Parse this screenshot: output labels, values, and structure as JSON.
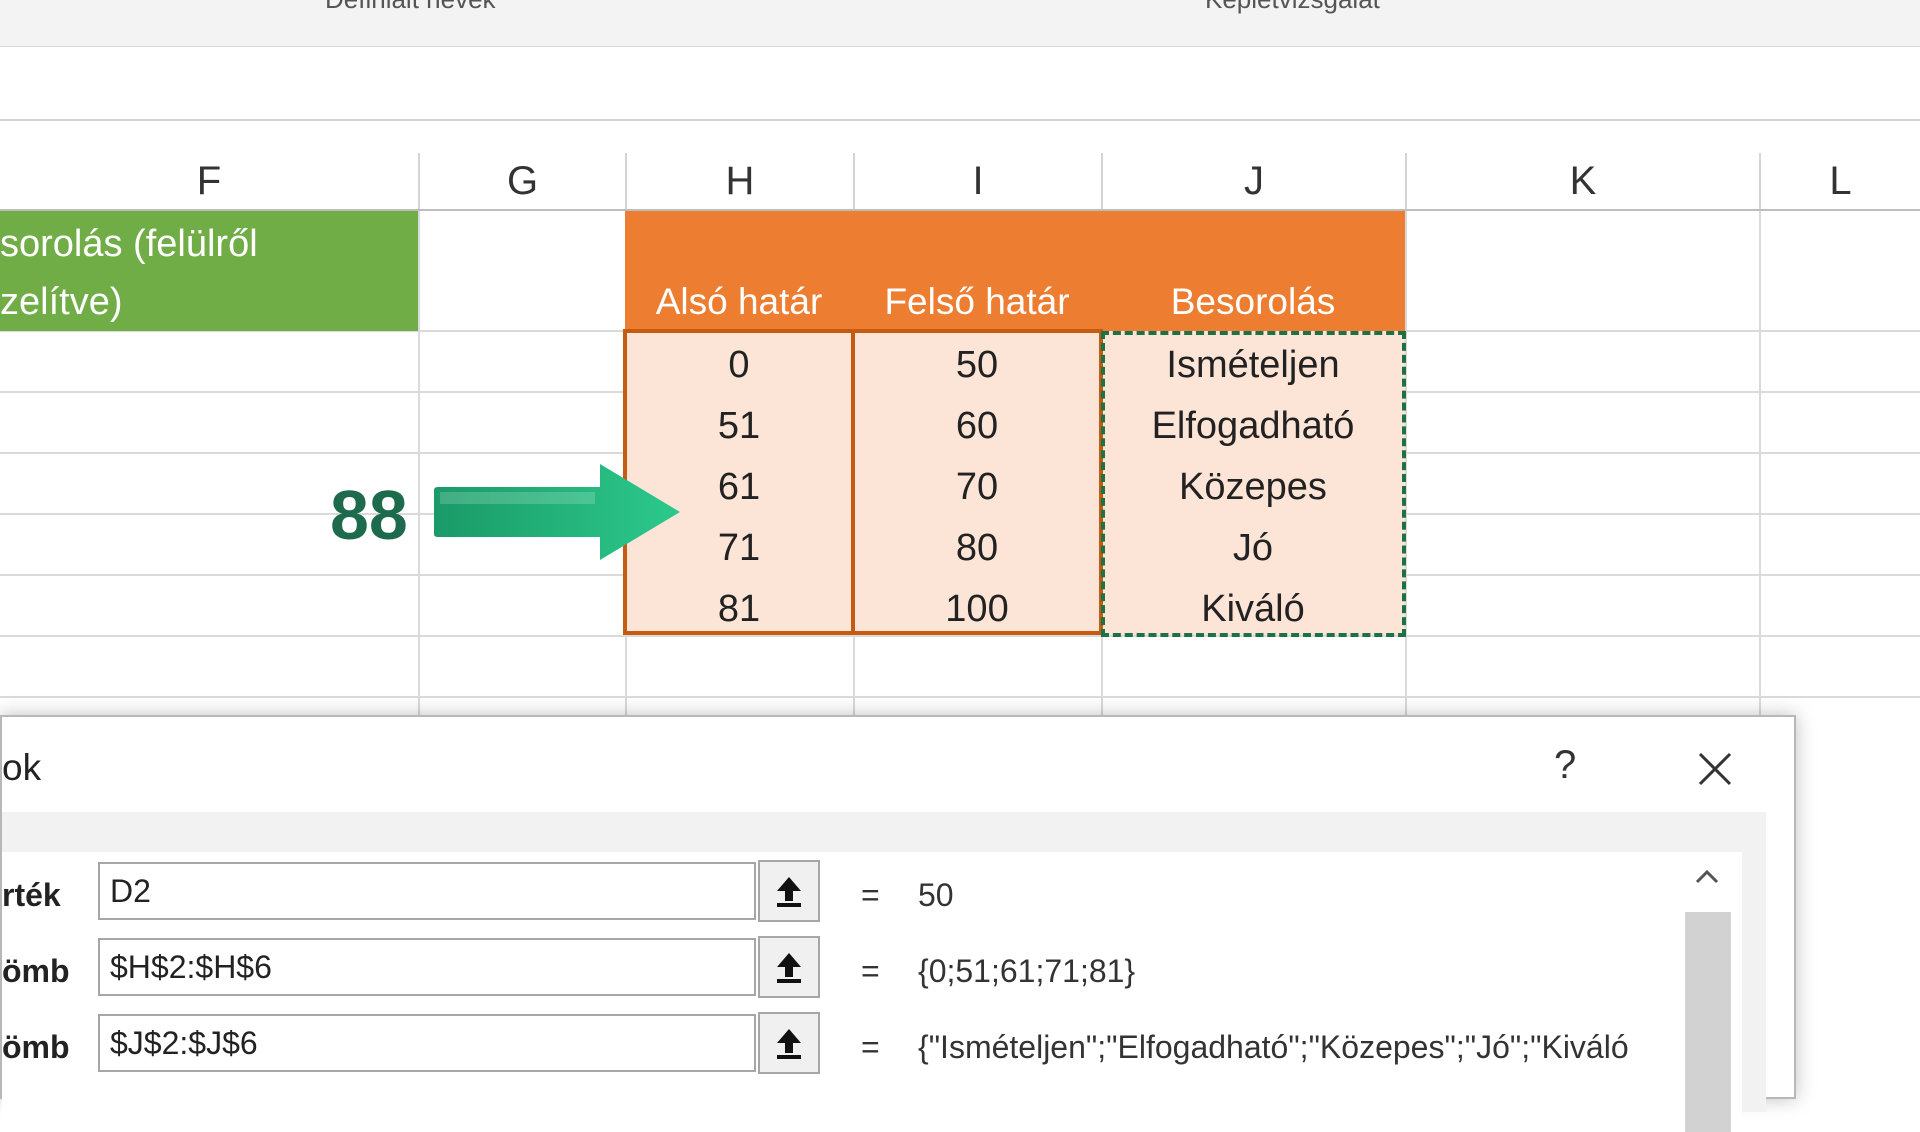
{
  "ribbon": {
    "left_text": "Definiált nevek",
    "right_text": "Képletvizsgálat"
  },
  "columns": [
    "F",
    "G",
    "H",
    "I",
    "J",
    "K",
    "L"
  ],
  "green_header": {
    "line1": "sorolás (felülről",
    "line2": "zelítve)"
  },
  "table": {
    "headers": [
      "Alsó határ",
      "Felső határ",
      "Besorolás"
    ],
    "lower": [
      "0",
      "51",
      "61",
      "71",
      "81"
    ],
    "upper": [
      "50",
      "60",
      "70",
      "80",
      "100"
    ],
    "grade": [
      "Ismételjen",
      "Elfogadható",
      "Közepes",
      "Jó",
      "Kiváló"
    ]
  },
  "lookup_value": "88",
  "colors": {
    "green": "#70ad47",
    "orange": "#ed7d31",
    "pink": "#fce4d6",
    "arrow": "#1fb37a",
    "number": "#1d6b4c"
  },
  "dialog": {
    "title": "ok",
    "help": "?",
    "args": [
      {
        "label": "rték",
        "value": "D2",
        "eq": "=",
        "result": "50"
      },
      {
        "label": "ömb",
        "value": "$H$2:$H$6",
        "eq": "=",
        "result": "{0;51;61;71;81}"
      },
      {
        "label": "ömb",
        "value": "$J$2:$J$6",
        "eq": "=",
        "result": "{\"Ismételjen\";\"Elfogadható\";\"Közepes\";\"Jó\";\"Kiváló"
      }
    ]
  }
}
